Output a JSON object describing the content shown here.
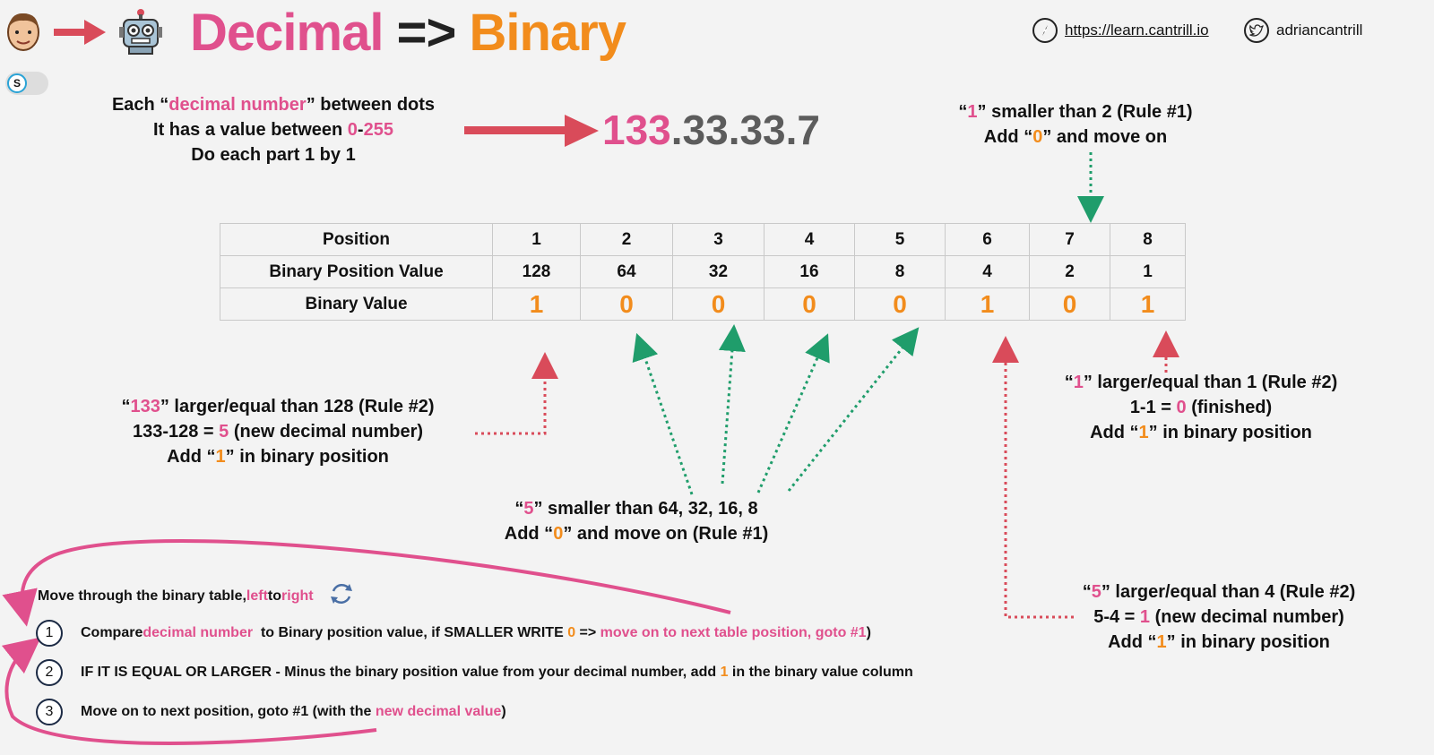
{
  "header": {
    "title_decimal": "Decimal",
    "title_arrow": "=>",
    "title_binary": "Binary",
    "site_url": "https://learn.cantrill.io",
    "twitter_handle": "adriancantrill",
    "toggle_label": "S"
  },
  "intro": {
    "line1_pre": "Each “",
    "line1_hl": "decimal number",
    "line1_post": "” between dots",
    "line2_pre": "It has a value between ",
    "line2_a": "0",
    "line2_dash": "-",
    "line2_b": "255",
    "line3": "Do each part 1 by 1"
  },
  "ip": {
    "first": "133",
    "rest": ".33.33.7"
  },
  "table": {
    "row_labels": [
      "Position",
      "Binary Position Value",
      "Binary Value"
    ],
    "positions": [
      "1",
      "2",
      "3",
      "4",
      "5",
      "6",
      "7",
      "8"
    ],
    "position_values": [
      "128",
      "64",
      "32",
      "16",
      "8",
      "4",
      "2",
      "1"
    ],
    "binary_values": [
      "1",
      "0",
      "0",
      "0",
      "0",
      "1",
      "0",
      "1"
    ]
  },
  "notes": {
    "pos7": {
      "l1_pre": "“",
      "l1_hl": "1",
      "l1_post": "” smaller than 2 (Rule #1)",
      "l2_pre": "Add “",
      "l2_hl": "0",
      "l2_post": "” and move on"
    },
    "pos1": {
      "l1_pre": "“",
      "l1_hl": "133",
      "l1_post": "” larger/equal than 128 (Rule #2)",
      "l2_pre": "133-128 = ",
      "l2_hl": "5",
      "l2_post": " (new decimal number)",
      "l3_pre": "Add “",
      "l3_hl": "1",
      "l3_post": "” in binary position"
    },
    "pos2to5": {
      "l1_pre": "“",
      "l1_hl": "5",
      "l1_post": "” smaller than 64, 32, 16, 8",
      "l2_pre": "Add “",
      "l2_hl": "0",
      "l2_post": "” and move on (Rule #1)"
    },
    "pos8": {
      "l1_pre": "“",
      "l1_hl": "1",
      "l1_post": "” larger/equal than 1 (Rule #2)",
      "l2_pre": "1-1 = ",
      "l2_hl": "0",
      "l2_post": " (finished)",
      "l3_pre": "Add “",
      "l3_hl": "1",
      "l3_post": "” in binary position"
    },
    "pos6": {
      "l1_pre": "“",
      "l1_hl": "5",
      "l1_post": "” larger/equal than 4 (Rule #2)",
      "l2_pre": "5-4 = ",
      "l2_hl": "1",
      "l2_post": " (new decimal number)",
      "l3_pre": "Add “",
      "l3_hl": "1",
      "l3_post": "” in binary position"
    }
  },
  "steps": {
    "intro_pre": "Move through the binary table, ",
    "intro_left": "left",
    "intro_to": " to ",
    "intro_right": "right",
    "s1_num": "1",
    "s1_a": "Compare ",
    "s1_b": "decimal number",
    "s1_c": "  to Binary position value, if SMALLER WRITE ",
    "s1_d": "0",
    "s1_e": " => ",
    "s1_f": "move on to next table position, goto #1",
    "s1_g": ")",
    "s2_num": "2",
    "s2_a": "IF IT IS EQUAL OR LARGER - Minus the binary position value from your decimal number, add ",
    "s2_b": "1",
    "s2_c": " in the binary value column",
    "s3_num": "3",
    "s3_a": "Move on to next position, goto #1 (with the ",
    "s3_b": "new decimal value",
    "s3_c": ")"
  },
  "colors": {
    "pink": "#e0508d",
    "orange": "#f28c1c",
    "red_arrow": "#d94b5a",
    "green_arrow": "#1f9d6b"
  }
}
